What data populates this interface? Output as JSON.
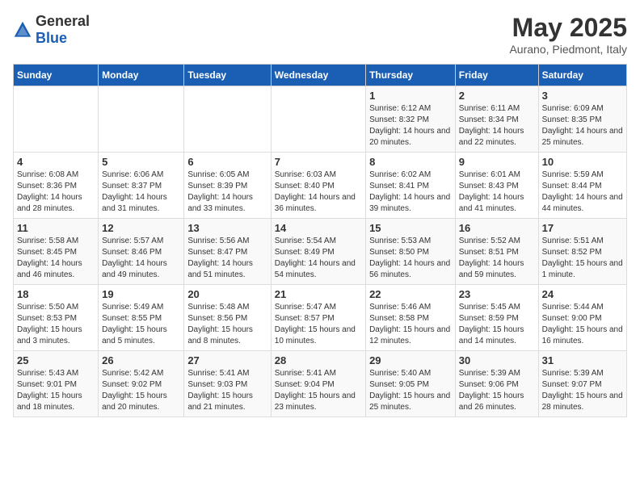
{
  "logo": {
    "general": "General",
    "blue": "Blue"
  },
  "title": "May 2025",
  "subtitle": "Aurano, Piedmont, Italy",
  "days_of_week": [
    "Sunday",
    "Monday",
    "Tuesday",
    "Wednesday",
    "Thursday",
    "Friday",
    "Saturday"
  ],
  "weeks": [
    [
      {
        "day": "",
        "info": ""
      },
      {
        "day": "",
        "info": ""
      },
      {
        "day": "",
        "info": ""
      },
      {
        "day": "",
        "info": ""
      },
      {
        "day": "1",
        "info": "Sunrise: 6:12 AM\nSunset: 8:32 PM\nDaylight: 14 hours and 20 minutes."
      },
      {
        "day": "2",
        "info": "Sunrise: 6:11 AM\nSunset: 8:34 PM\nDaylight: 14 hours and 22 minutes."
      },
      {
        "day": "3",
        "info": "Sunrise: 6:09 AM\nSunset: 8:35 PM\nDaylight: 14 hours and 25 minutes."
      }
    ],
    [
      {
        "day": "4",
        "info": "Sunrise: 6:08 AM\nSunset: 8:36 PM\nDaylight: 14 hours and 28 minutes."
      },
      {
        "day": "5",
        "info": "Sunrise: 6:06 AM\nSunset: 8:37 PM\nDaylight: 14 hours and 31 minutes."
      },
      {
        "day": "6",
        "info": "Sunrise: 6:05 AM\nSunset: 8:39 PM\nDaylight: 14 hours and 33 minutes."
      },
      {
        "day": "7",
        "info": "Sunrise: 6:03 AM\nSunset: 8:40 PM\nDaylight: 14 hours and 36 minutes."
      },
      {
        "day": "8",
        "info": "Sunrise: 6:02 AM\nSunset: 8:41 PM\nDaylight: 14 hours and 39 minutes."
      },
      {
        "day": "9",
        "info": "Sunrise: 6:01 AM\nSunset: 8:43 PM\nDaylight: 14 hours and 41 minutes."
      },
      {
        "day": "10",
        "info": "Sunrise: 5:59 AM\nSunset: 8:44 PM\nDaylight: 14 hours and 44 minutes."
      }
    ],
    [
      {
        "day": "11",
        "info": "Sunrise: 5:58 AM\nSunset: 8:45 PM\nDaylight: 14 hours and 46 minutes."
      },
      {
        "day": "12",
        "info": "Sunrise: 5:57 AM\nSunset: 8:46 PM\nDaylight: 14 hours and 49 minutes."
      },
      {
        "day": "13",
        "info": "Sunrise: 5:56 AM\nSunset: 8:47 PM\nDaylight: 14 hours and 51 minutes."
      },
      {
        "day": "14",
        "info": "Sunrise: 5:54 AM\nSunset: 8:49 PM\nDaylight: 14 hours and 54 minutes."
      },
      {
        "day": "15",
        "info": "Sunrise: 5:53 AM\nSunset: 8:50 PM\nDaylight: 14 hours and 56 minutes."
      },
      {
        "day": "16",
        "info": "Sunrise: 5:52 AM\nSunset: 8:51 PM\nDaylight: 14 hours and 59 minutes."
      },
      {
        "day": "17",
        "info": "Sunrise: 5:51 AM\nSunset: 8:52 PM\nDaylight: 15 hours and 1 minute."
      }
    ],
    [
      {
        "day": "18",
        "info": "Sunrise: 5:50 AM\nSunset: 8:53 PM\nDaylight: 15 hours and 3 minutes."
      },
      {
        "day": "19",
        "info": "Sunrise: 5:49 AM\nSunset: 8:55 PM\nDaylight: 15 hours and 5 minutes."
      },
      {
        "day": "20",
        "info": "Sunrise: 5:48 AM\nSunset: 8:56 PM\nDaylight: 15 hours and 8 minutes."
      },
      {
        "day": "21",
        "info": "Sunrise: 5:47 AM\nSunset: 8:57 PM\nDaylight: 15 hours and 10 minutes."
      },
      {
        "day": "22",
        "info": "Sunrise: 5:46 AM\nSunset: 8:58 PM\nDaylight: 15 hours and 12 minutes."
      },
      {
        "day": "23",
        "info": "Sunrise: 5:45 AM\nSunset: 8:59 PM\nDaylight: 15 hours and 14 minutes."
      },
      {
        "day": "24",
        "info": "Sunrise: 5:44 AM\nSunset: 9:00 PM\nDaylight: 15 hours and 16 minutes."
      }
    ],
    [
      {
        "day": "25",
        "info": "Sunrise: 5:43 AM\nSunset: 9:01 PM\nDaylight: 15 hours and 18 minutes."
      },
      {
        "day": "26",
        "info": "Sunrise: 5:42 AM\nSunset: 9:02 PM\nDaylight: 15 hours and 20 minutes."
      },
      {
        "day": "27",
        "info": "Sunrise: 5:41 AM\nSunset: 9:03 PM\nDaylight: 15 hours and 21 minutes."
      },
      {
        "day": "28",
        "info": "Sunrise: 5:41 AM\nSunset: 9:04 PM\nDaylight: 15 hours and 23 minutes."
      },
      {
        "day": "29",
        "info": "Sunrise: 5:40 AM\nSunset: 9:05 PM\nDaylight: 15 hours and 25 minutes."
      },
      {
        "day": "30",
        "info": "Sunrise: 5:39 AM\nSunset: 9:06 PM\nDaylight: 15 hours and 26 minutes."
      },
      {
        "day": "31",
        "info": "Sunrise: 5:39 AM\nSunset: 9:07 PM\nDaylight: 15 hours and 28 minutes."
      }
    ]
  ]
}
